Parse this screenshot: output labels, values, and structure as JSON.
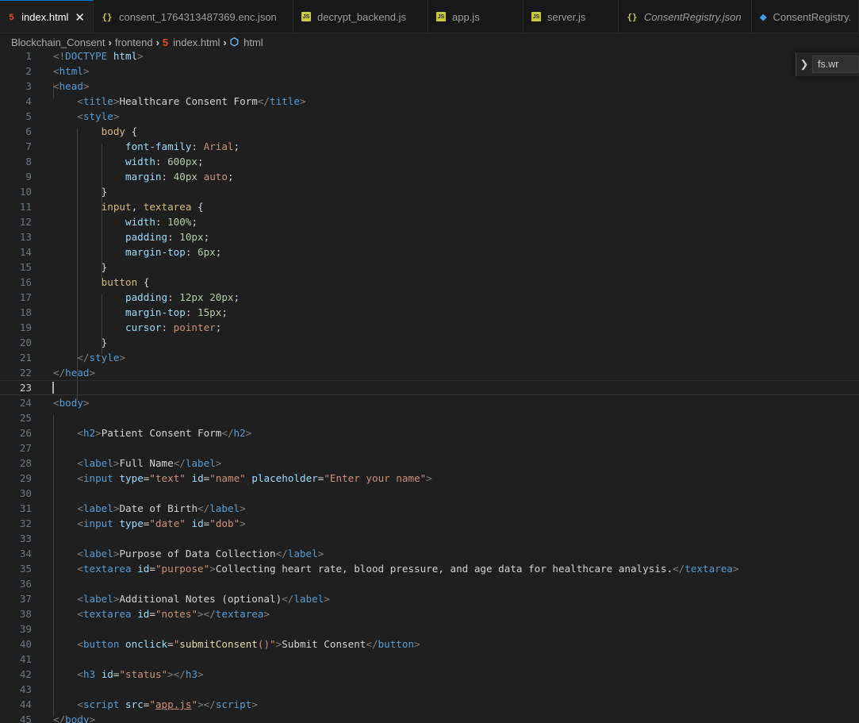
{
  "tabs": [
    {
      "label": "index.html",
      "icon": "html5-icon",
      "kind": "html",
      "active": true,
      "close": "✕"
    },
    {
      "label": "consent_1764313487369.enc.json",
      "icon": "json-braces-icon",
      "kind": "json"
    },
    {
      "label": "decrypt_backend.js",
      "icon": "js-icon",
      "kind": "js"
    },
    {
      "label": "app.js",
      "icon": "js-icon",
      "kind": "js"
    },
    {
      "label": "server.js",
      "icon": "js-icon",
      "kind": "js"
    },
    {
      "label": "ConsentRegistry.json",
      "icon": "json-braces-icon",
      "kind": "json",
      "italic": true
    },
    {
      "label": "ConsentRegistry.",
      "icon": "solidity-icon",
      "kind": "sol"
    }
  ],
  "breadcrumb": {
    "items": [
      "Blockchain_Consent",
      "frontend",
      "index.html",
      "html"
    ]
  },
  "find_widget": {
    "value": "fs.wr"
  },
  "current_line": 23,
  "lines": [
    {
      "n": "1",
      "tokens": [
        [
          "br",
          "<!"
        ],
        [
          "tag",
          "DOCTYPE"
        ],
        [
          "attr",
          " html"
        ],
        [
          "br",
          ">"
        ]
      ]
    },
    {
      "n": "2",
      "tokens": [
        [
          "br",
          "<"
        ],
        [
          "tag",
          "html"
        ],
        [
          "br",
          ">"
        ]
      ]
    },
    {
      "n": "3",
      "tokens": [
        [
          "br",
          "<"
        ],
        [
          "tag",
          "head"
        ],
        [
          "br",
          ">"
        ]
      ]
    },
    {
      "n": "4",
      "tokens": [
        [
          "txt",
          "    "
        ],
        [
          "br",
          "<"
        ],
        [
          "tag",
          "title"
        ],
        [
          "br",
          ">"
        ],
        [
          "txt",
          "Healthcare Consent Form"
        ],
        [
          "br",
          "</"
        ],
        [
          "tag",
          "title"
        ],
        [
          "br",
          ">"
        ]
      ]
    },
    {
      "n": "5",
      "tokens": [
        [
          "txt",
          "    "
        ],
        [
          "br",
          "<"
        ],
        [
          "tag",
          "style"
        ],
        [
          "br",
          ">"
        ]
      ]
    },
    {
      "n": "6",
      "tokens": [
        [
          "txt",
          "        "
        ],
        [
          "sel",
          "body"
        ],
        [
          "txt",
          " {"
        ]
      ]
    },
    {
      "n": "7",
      "tokens": [
        [
          "txt",
          "            "
        ],
        [
          "attr",
          "font-family"
        ],
        [
          "txt",
          ": "
        ],
        [
          "str",
          "Arial"
        ],
        [
          "txt",
          ";"
        ]
      ]
    },
    {
      "n": "8",
      "tokens": [
        [
          "txt",
          "            "
        ],
        [
          "attr",
          "width"
        ],
        [
          "txt",
          ": "
        ],
        [
          "num",
          "600px"
        ],
        [
          "txt",
          ";"
        ]
      ]
    },
    {
      "n": "9",
      "tokens": [
        [
          "txt",
          "            "
        ],
        [
          "attr",
          "margin"
        ],
        [
          "txt",
          ": "
        ],
        [
          "num",
          "40px"
        ],
        [
          "txt",
          " "
        ],
        [
          "str",
          "auto"
        ],
        [
          "txt",
          ";"
        ]
      ]
    },
    {
      "n": "10",
      "tokens": [
        [
          "txt",
          "        }"
        ]
      ]
    },
    {
      "n": "11",
      "tokens": [
        [
          "txt",
          "        "
        ],
        [
          "sel",
          "input"
        ],
        [
          "txt",
          ", "
        ],
        [
          "sel",
          "textarea"
        ],
        [
          "txt",
          " {"
        ]
      ]
    },
    {
      "n": "12",
      "tokens": [
        [
          "txt",
          "            "
        ],
        [
          "attr",
          "width"
        ],
        [
          "txt",
          ": "
        ],
        [
          "num",
          "100%"
        ],
        [
          "txt",
          ";"
        ]
      ]
    },
    {
      "n": "13",
      "tokens": [
        [
          "txt",
          "            "
        ],
        [
          "attr",
          "padding"
        ],
        [
          "txt",
          ": "
        ],
        [
          "num",
          "10px"
        ],
        [
          "txt",
          ";"
        ]
      ]
    },
    {
      "n": "14",
      "tokens": [
        [
          "txt",
          "            "
        ],
        [
          "attr",
          "margin-top"
        ],
        [
          "txt",
          ": "
        ],
        [
          "num",
          "6px"
        ],
        [
          "txt",
          ";"
        ]
      ]
    },
    {
      "n": "15",
      "tokens": [
        [
          "txt",
          "        }"
        ]
      ]
    },
    {
      "n": "16",
      "tokens": [
        [
          "txt",
          "        "
        ],
        [
          "sel",
          "button"
        ],
        [
          "txt",
          " {"
        ]
      ]
    },
    {
      "n": "17",
      "tokens": [
        [
          "txt",
          "            "
        ],
        [
          "attr",
          "padding"
        ],
        [
          "txt",
          ": "
        ],
        [
          "num",
          "12px"
        ],
        [
          "txt",
          " "
        ],
        [
          "num",
          "20px"
        ],
        [
          "txt",
          ";"
        ]
      ]
    },
    {
      "n": "18",
      "tokens": [
        [
          "txt",
          "            "
        ],
        [
          "attr",
          "margin-top"
        ],
        [
          "txt",
          ": "
        ],
        [
          "num",
          "15px"
        ],
        [
          "txt",
          ";"
        ]
      ]
    },
    {
      "n": "19",
      "tokens": [
        [
          "txt",
          "            "
        ],
        [
          "attr",
          "cursor"
        ],
        [
          "txt",
          ": "
        ],
        [
          "str",
          "pointer"
        ],
        [
          "txt",
          ";"
        ]
      ]
    },
    {
      "n": "20",
      "tokens": [
        [
          "txt",
          "        }"
        ]
      ]
    },
    {
      "n": "21",
      "tokens": [
        [
          "txt",
          "    "
        ],
        [
          "br",
          "</"
        ],
        [
          "tag",
          "style"
        ],
        [
          "br",
          ">"
        ]
      ]
    },
    {
      "n": "22",
      "tokens": [
        [
          "br",
          "</"
        ],
        [
          "tag",
          "head"
        ],
        [
          "br",
          ">"
        ]
      ]
    },
    {
      "n": "23",
      "tokens": []
    },
    {
      "n": "24",
      "tokens": [
        [
          "br",
          "<"
        ],
        [
          "tag",
          "body"
        ],
        [
          "br",
          ">"
        ]
      ]
    },
    {
      "n": "25",
      "tokens": []
    },
    {
      "n": "26",
      "tokens": [
        [
          "txt",
          "    "
        ],
        [
          "br",
          "<"
        ],
        [
          "tag",
          "h2"
        ],
        [
          "br",
          ">"
        ],
        [
          "txt",
          "Patient Consent Form"
        ],
        [
          "br",
          "</"
        ],
        [
          "tag",
          "h2"
        ],
        [
          "br",
          ">"
        ]
      ]
    },
    {
      "n": "27",
      "tokens": []
    },
    {
      "n": "28",
      "tokens": [
        [
          "txt",
          "    "
        ],
        [
          "br",
          "<"
        ],
        [
          "tag",
          "label"
        ],
        [
          "br",
          ">"
        ],
        [
          "txt",
          "Full Name"
        ],
        [
          "br",
          "</"
        ],
        [
          "tag",
          "label"
        ],
        [
          "br",
          ">"
        ]
      ]
    },
    {
      "n": "29",
      "tokens": [
        [
          "txt",
          "    "
        ],
        [
          "br",
          "<"
        ],
        [
          "tag",
          "input"
        ],
        [
          "txt",
          " "
        ],
        [
          "attr",
          "type"
        ],
        [
          "txt",
          "="
        ],
        [
          "str",
          "\"text\""
        ],
        [
          "txt",
          " "
        ],
        [
          "attr",
          "id"
        ],
        [
          "txt",
          "="
        ],
        [
          "str",
          "\"name\""
        ],
        [
          "txt",
          " "
        ],
        [
          "attr",
          "placeholder"
        ],
        [
          "txt",
          "="
        ],
        [
          "str",
          "\"Enter your name\""
        ],
        [
          "br",
          ">"
        ]
      ]
    },
    {
      "n": "30",
      "tokens": []
    },
    {
      "n": "31",
      "tokens": [
        [
          "txt",
          "    "
        ],
        [
          "br",
          "<"
        ],
        [
          "tag",
          "label"
        ],
        [
          "br",
          ">"
        ],
        [
          "txt",
          "Date of Birth"
        ],
        [
          "br",
          "</"
        ],
        [
          "tag",
          "label"
        ],
        [
          "br",
          ">"
        ]
      ]
    },
    {
      "n": "32",
      "tokens": [
        [
          "txt",
          "    "
        ],
        [
          "br",
          "<"
        ],
        [
          "tag",
          "input"
        ],
        [
          "txt",
          " "
        ],
        [
          "attr",
          "type"
        ],
        [
          "txt",
          "="
        ],
        [
          "str",
          "\"date\""
        ],
        [
          "txt",
          " "
        ],
        [
          "attr",
          "id"
        ],
        [
          "txt",
          "="
        ],
        [
          "str",
          "\"dob\""
        ],
        [
          "br",
          ">"
        ]
      ]
    },
    {
      "n": "33",
      "tokens": []
    },
    {
      "n": "34",
      "tokens": [
        [
          "txt",
          "    "
        ],
        [
          "br",
          "<"
        ],
        [
          "tag",
          "label"
        ],
        [
          "br",
          ">"
        ],
        [
          "txt",
          "Purpose of Data Collection"
        ],
        [
          "br",
          "</"
        ],
        [
          "tag",
          "label"
        ],
        [
          "br",
          ">"
        ]
      ]
    },
    {
      "n": "35",
      "tokens": [
        [
          "txt",
          "    "
        ],
        [
          "br",
          "<"
        ],
        [
          "tag",
          "textarea"
        ],
        [
          "txt",
          " "
        ],
        [
          "attr",
          "id"
        ],
        [
          "txt",
          "="
        ],
        [
          "str",
          "\"purpose\""
        ],
        [
          "br",
          ">"
        ],
        [
          "txt",
          "Collecting heart rate, blood pressure, and age data for healthcare analysis."
        ],
        [
          "br",
          "</"
        ],
        [
          "tag",
          "textarea"
        ],
        [
          "br",
          ">"
        ]
      ]
    },
    {
      "n": "36",
      "tokens": []
    },
    {
      "n": "37",
      "tokens": [
        [
          "txt",
          "    "
        ],
        [
          "br",
          "<"
        ],
        [
          "tag",
          "label"
        ],
        [
          "br",
          ">"
        ],
        [
          "txt",
          "Additional Notes (optional)"
        ],
        [
          "br",
          "</"
        ],
        [
          "tag",
          "label"
        ],
        [
          "br",
          ">"
        ]
      ]
    },
    {
      "n": "38",
      "tokens": [
        [
          "txt",
          "    "
        ],
        [
          "br",
          "<"
        ],
        [
          "tag",
          "textarea"
        ],
        [
          "txt",
          " "
        ],
        [
          "attr",
          "id"
        ],
        [
          "txt",
          "="
        ],
        [
          "str",
          "\"notes\""
        ],
        [
          "br",
          "></"
        ],
        [
          "tag",
          "textarea"
        ],
        [
          "br",
          ">"
        ]
      ]
    },
    {
      "n": "39",
      "tokens": []
    },
    {
      "n": "40",
      "tokens": [
        [
          "txt",
          "    "
        ],
        [
          "br",
          "<"
        ],
        [
          "tag",
          "button"
        ],
        [
          "txt",
          " "
        ],
        [
          "attr",
          "onclick"
        ],
        [
          "txt",
          "="
        ],
        [
          "str",
          "\""
        ],
        [
          "fn",
          "submitConsent"
        ],
        [
          "str",
          "()\""
        ],
        [
          "br",
          ">"
        ],
        [
          "txt",
          "Submit Consent"
        ],
        [
          "br",
          "</"
        ],
        [
          "tag",
          "button"
        ],
        [
          "br",
          ">"
        ]
      ]
    },
    {
      "n": "41",
      "tokens": []
    },
    {
      "n": "42",
      "tokens": [
        [
          "txt",
          "    "
        ],
        [
          "br",
          "<"
        ],
        [
          "tag",
          "h3"
        ],
        [
          "txt",
          " "
        ],
        [
          "attr",
          "id"
        ],
        [
          "txt",
          "="
        ],
        [
          "str",
          "\"status\""
        ],
        [
          "br",
          "></"
        ],
        [
          "tag",
          "h3"
        ],
        [
          "br",
          ">"
        ]
      ]
    },
    {
      "n": "43",
      "tokens": []
    },
    {
      "n": "44",
      "tokens": [
        [
          "txt",
          "    "
        ],
        [
          "br",
          "<"
        ],
        [
          "tag",
          "script"
        ],
        [
          "txt",
          " "
        ],
        [
          "attr",
          "src"
        ],
        [
          "txt",
          "="
        ],
        [
          "str",
          "\""
        ],
        [
          "link",
          "app.js"
        ],
        [
          "str",
          "\""
        ],
        [
          "br",
          "></"
        ],
        [
          "tag",
          "script"
        ],
        [
          "br",
          ">"
        ]
      ]
    },
    {
      "n": "45",
      "tokens": [
        [
          "br",
          "</"
        ],
        [
          "tag",
          "body"
        ],
        [
          "br",
          ">"
        ]
      ]
    }
  ]
}
